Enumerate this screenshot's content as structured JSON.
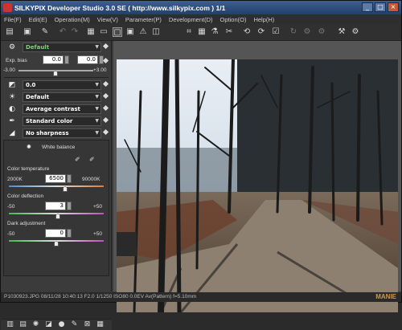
{
  "window": {
    "title": "SILKYPIX Developer Studio 3.0 SE ( http://www.silkypix.com )   1/1",
    "buttons": [
      "_",
      "□",
      "×"
    ]
  },
  "menu": [
    "File(F)",
    "Edit(E)",
    "Operation(M)",
    "View(V)",
    "Parameter(P)",
    "Development(D)",
    "Option(O)",
    "Help(H)"
  ],
  "toolbar": {
    "icons": [
      "folder-open-icon",
      "folder-icon",
      "eraser-icon",
      "undo-icon",
      "redo-icon",
      "thumbnail-view-icon",
      "list-view-icon",
      "single-view-icon",
      "fit-view-icon",
      "compare-view-icon",
      "warning-icon",
      "crop-icon",
      "grid-icon",
      "eyedropper-white-icon",
      "eyedropper-gray-icon",
      "rotate-left-icon",
      "rotate-right-icon",
      "check-icon",
      "refresh-icon",
      "develop-icon",
      "develop-all-icon",
      "hammer-icon",
      "settings-icon"
    ]
  },
  "left": {
    "taste": "Default",
    "exposure": {
      "label": "Exp. bias",
      "value1": "0.0",
      "value2": "0.0",
      "min": "-3.00",
      "max": "+3.00"
    },
    "rows": [
      {
        "icon": "contrast-icon",
        "value": "0.0"
      },
      {
        "icon": "sun-icon",
        "value": "Default"
      },
      {
        "icon": "half-circle-icon",
        "value": "Average contrast"
      },
      {
        "icon": "pen-icon",
        "value": "Standard color"
      },
      {
        "icon": "sharpness-icon",
        "value": "No sharpness"
      }
    ],
    "wb_title": "White balance",
    "color_temp": {
      "label": "Color temperature",
      "min": "2000K",
      "value": "6500",
      "max": "90000K"
    },
    "color_dev": {
      "label": "Color deflection",
      "min": "-50",
      "value": "3",
      "max": "+50"
    },
    "dark": {
      "label": "Dark adjustment",
      "min": "-50",
      "value": "0",
      "max": "+50"
    }
  },
  "status": {
    "text": "P1030923.JPG 08/11/28 10:40:13 F2.0 1/1250 ISO80  0.0EV Av(Pattern) f=5.10mm",
    "watermark": "MANIE"
  }
}
